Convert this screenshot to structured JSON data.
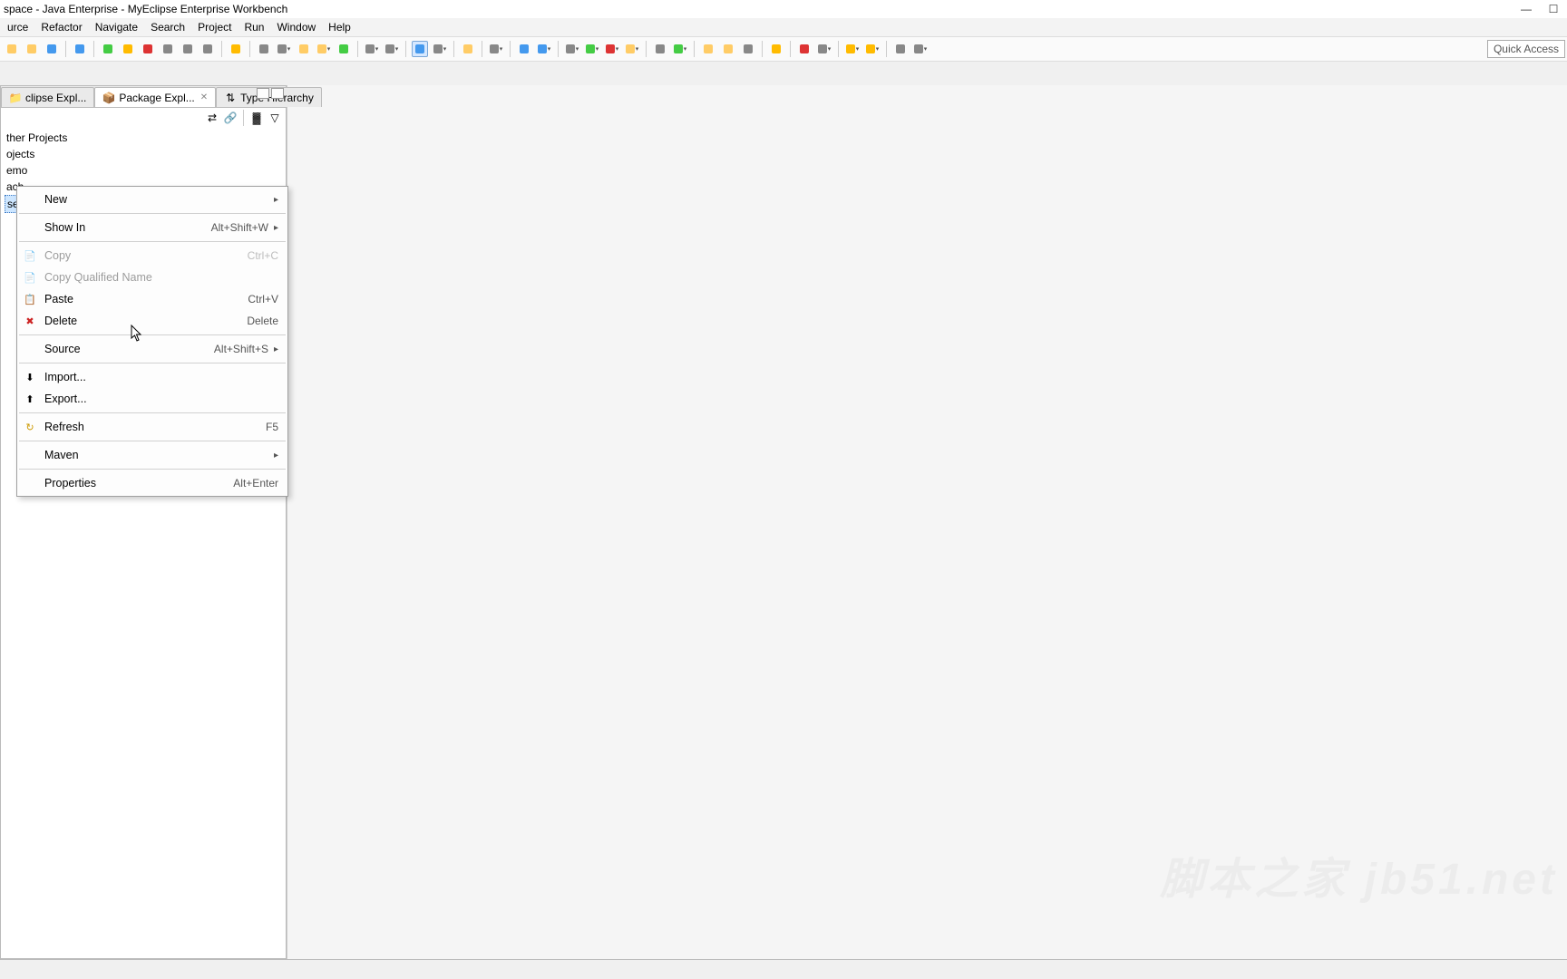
{
  "window": {
    "title": "space - Java Enterprise - MyEclipse Enterprise Workbench"
  },
  "menu": {
    "items": [
      "urce",
      "Refactor",
      "Navigate",
      "Search",
      "Project",
      "Run",
      "Window",
      "Help"
    ]
  },
  "quick_access": {
    "placeholder": "Quick Access"
  },
  "views": {
    "tabs": [
      {
        "label": "clipse Expl...",
        "active": false
      },
      {
        "label": "Package Expl...",
        "active": true
      },
      {
        "label": "Type Hierarchy",
        "active": false
      }
    ]
  },
  "tree": {
    "items": [
      "ther Projects",
      "ojects",
      "emo",
      "ach",
      "search"
    ],
    "selected_index": 4
  },
  "context_menu": {
    "items": [
      {
        "label": "New",
        "arrow": true
      },
      {
        "sep": true
      },
      {
        "label": "Show In",
        "accel": "Alt+Shift+W",
        "arrow": true
      },
      {
        "sep": true
      },
      {
        "label": "Copy",
        "accel": "Ctrl+C",
        "disabled": true,
        "icon": "copy"
      },
      {
        "label": "Copy Qualified Name",
        "disabled": true,
        "icon": "copy"
      },
      {
        "label": "Paste",
        "accel": "Ctrl+V",
        "icon": "paste"
      },
      {
        "label": "Delete",
        "accel": "Delete",
        "icon": "delete"
      },
      {
        "sep": true
      },
      {
        "label": "Source",
        "accel": "Alt+Shift+S",
        "arrow": true
      },
      {
        "sep": true
      },
      {
        "label": "Import...",
        "icon": "import"
      },
      {
        "label": "Export...",
        "icon": "export"
      },
      {
        "sep": true
      },
      {
        "label": "Refresh",
        "accel": "F5",
        "icon": "refresh"
      },
      {
        "sep": true
      },
      {
        "label": "Maven",
        "arrow": true
      },
      {
        "sep": true
      },
      {
        "label": "Properties",
        "accel": "Alt+Enter"
      }
    ]
  },
  "watermark": "脚本之家 jb51.net"
}
